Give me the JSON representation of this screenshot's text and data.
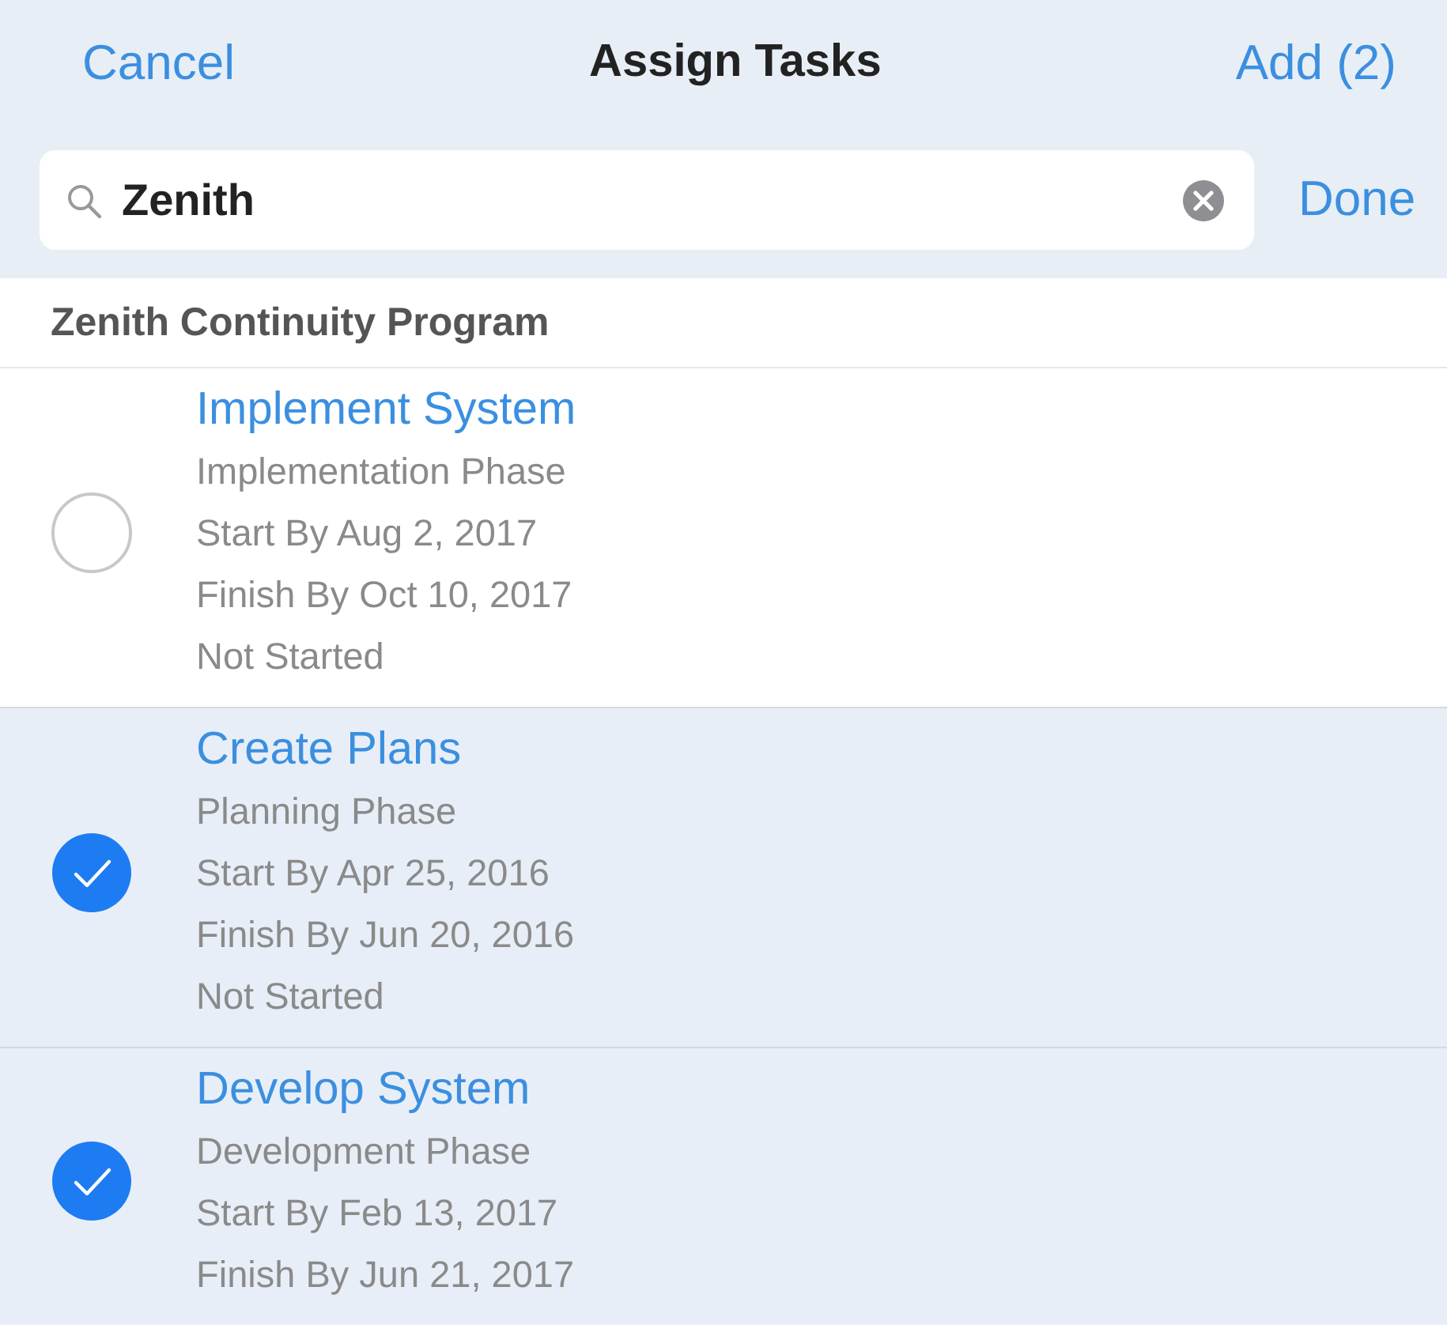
{
  "nav": {
    "cancel": "Cancel",
    "title": "Assign Tasks",
    "add": "Add (2)"
  },
  "search": {
    "value": "Zenith",
    "done": "Done"
  },
  "section": {
    "title": "Zenith Continuity Program"
  },
  "tasks": [
    {
      "title": "Implement System",
      "details": [
        "Implementation Phase",
        "Start By Aug 2, 2017",
        "Finish By Oct 10, 2017",
        "Not Started"
      ],
      "selected": false
    },
    {
      "title": "Create Plans",
      "details": [
        "Planning Phase",
        "Start By Apr 25, 2016",
        "Finish By Jun 20, 2016",
        "Not Started"
      ],
      "selected": true
    },
    {
      "title": "Develop System",
      "details": [
        "Development Phase",
        "Start By Feb 13, 2017",
        "Finish By Jun 21, 2017"
      ],
      "selected": true
    }
  ]
}
